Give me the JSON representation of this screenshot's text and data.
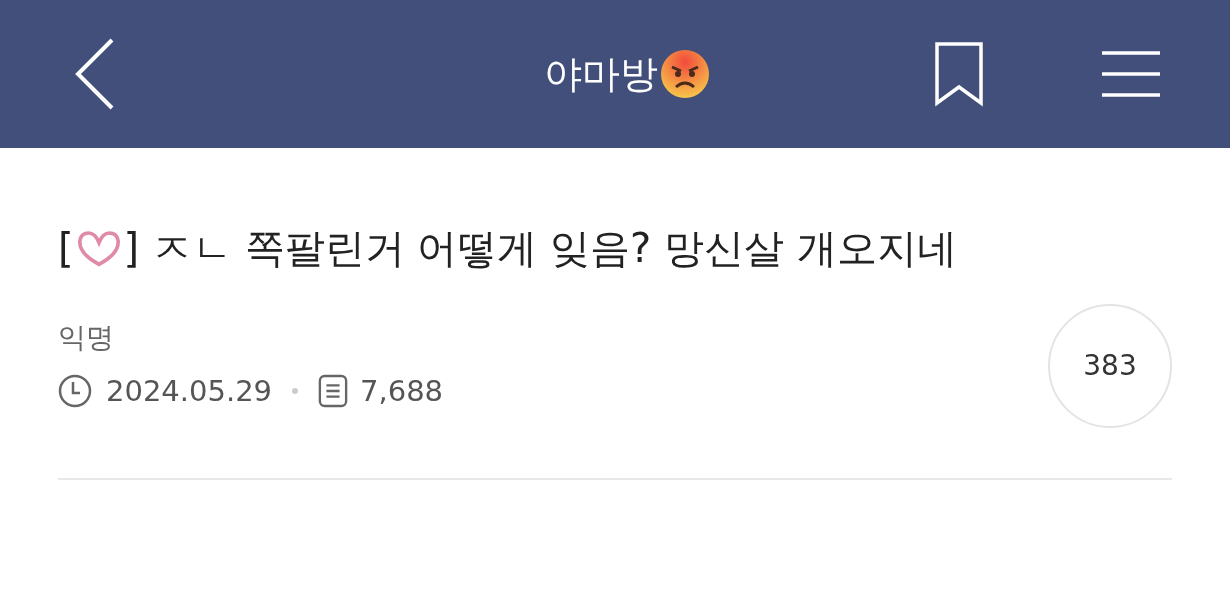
{
  "header": {
    "title": "야마방"
  },
  "post": {
    "title_open": "[",
    "title_rest": "] ㅈㄴ 쪽팔린거 어떻게 잊음? 망신살 개오지네",
    "author": "익명",
    "date": "2024.05.29",
    "views": "7,688",
    "comments": "383"
  }
}
